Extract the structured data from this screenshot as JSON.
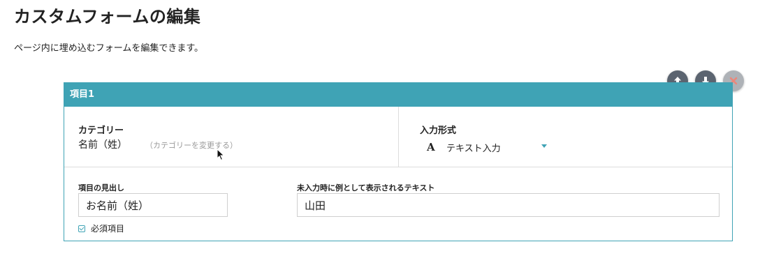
{
  "page": {
    "title": "カスタムフォームの編集",
    "description": "ページ内に埋め込むフォームを編集できます。"
  },
  "item": {
    "header": "項目1",
    "category": {
      "label": "カテゴリー",
      "value": "名前（姓）",
      "change_link": "（カテゴリーを変更する）"
    },
    "input_type": {
      "label": "入力形式",
      "glyph": "A",
      "value": "テキスト入力"
    },
    "heading": {
      "label": "項目の見出し",
      "value": "お名前（姓）"
    },
    "placeholder": {
      "label": "未入力時に例として表示されるテキスト",
      "value": "山田"
    },
    "required": {
      "label": "必須項目",
      "checked": true
    }
  },
  "controls": {
    "move_up_icon": "arrow-up-icon",
    "move_down_icon": "arrow-down-icon",
    "delete_icon": "close-icon"
  },
  "colors": {
    "accent": "#3fa3b5",
    "button_dark": "#5b6470",
    "delete_color": "#e86a5a"
  }
}
